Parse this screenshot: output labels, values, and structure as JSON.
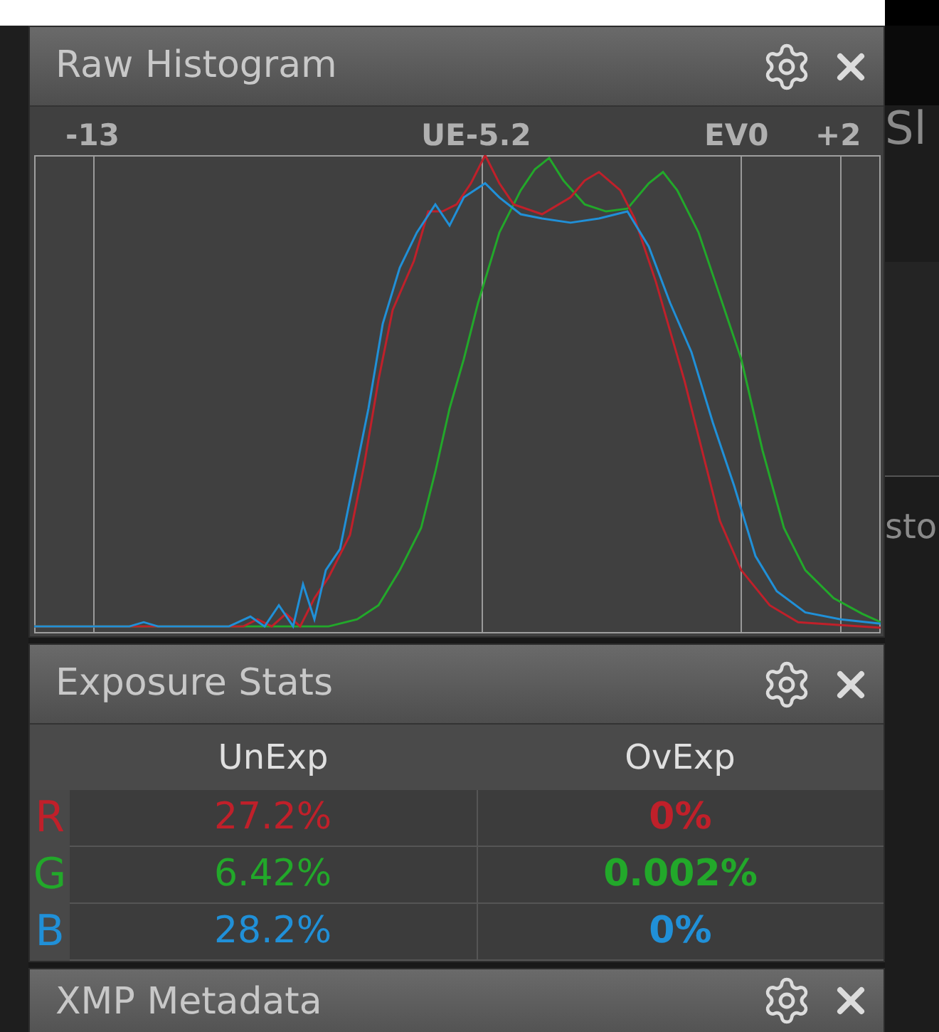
{
  "background": {
    "texts": [
      "Sl",
      "sto"
    ]
  },
  "histogram_panel": {
    "title": "Raw Histogram",
    "axis_labels": [
      "-13",
      "UE-5.2",
      "EV0",
      "+2"
    ]
  },
  "stats_panel": {
    "title": "Exposure Stats",
    "columns": [
      "UnExp",
      "OvExp"
    ],
    "rows": [
      {
        "channel": "R",
        "color": "#c0202a",
        "unexp": "27.2%",
        "ovexp": "0%"
      },
      {
        "channel": "G",
        "color": "#22a82a",
        "unexp": "6.42%",
        "ovexp": "0.002%"
      },
      {
        "channel": "B",
        "color": "#2090d8",
        "unexp": "28.2%",
        "ovexp": "0%"
      }
    ]
  },
  "xmp_panel": {
    "title": "XMP Metadata"
  }
}
